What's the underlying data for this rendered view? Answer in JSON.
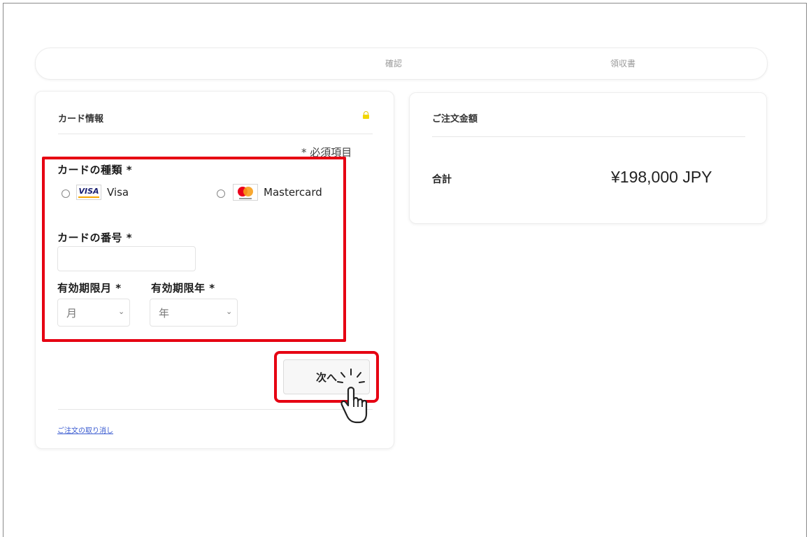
{
  "steps": [
    "確認",
    "領収書"
  ],
  "card_section": {
    "title": "カード情報",
    "required_note": "* 必須項目",
    "card_type_label": "カードの種類 *",
    "options": [
      {
        "logo": "VISA",
        "label": "Visa"
      },
      {
        "logo": "mastercard-logo",
        "label": "Mastercard"
      }
    ],
    "card_number_label": "カードの番号 *",
    "card_number_value": "",
    "exp_month_label": "有効期限月 *",
    "exp_month_value": "月",
    "exp_year_label": "有効期限年 *",
    "exp_year_value": "年",
    "next_button": "次へ",
    "cancel_link": "ご注文の取り消し"
  },
  "order_summary": {
    "title": "ご注文金額",
    "total_label": "合計",
    "total_value": "¥198,000 JPY"
  },
  "colors": {
    "highlight": "#e60012",
    "lock": "#f2d600",
    "link": "#3a5bd0"
  },
  "icons": [
    "lock-icon",
    "chevron-down-icon",
    "pointer-hand-icon"
  ]
}
